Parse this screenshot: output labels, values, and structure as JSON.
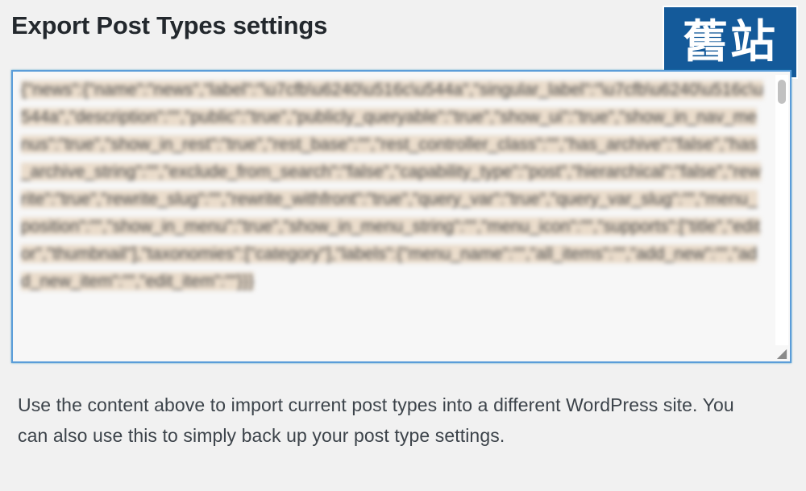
{
  "header": {
    "title": "Export Post Types settings"
  },
  "watermark": {
    "text": "舊站",
    "background_color": "#145a9a"
  },
  "export": {
    "content": "{\"news\":{\"name\":\"news\",\"label\":\"\\u7cfb\\u6240\\u516c\\u544a\",\"singular_label\":\"\\u7cfb\\u6240\\u516c\\u544a\",\"description\":\"\",\"public\":\"true\",\"publicly_queryable\":\"true\",\"show_ui\":\"true\",\"show_in_nav_menus\":\"true\",\"show_in_rest\":\"true\",\"rest_base\":\"\",\"rest_controller_class\":\"\",\"has_archive\":\"false\",\"has_archive_string\":\"\",\"exclude_from_search\":\"false\",\"capability_type\":\"post\",\"hierarchical\":\"false\",\"rewrite\":\"true\",\"rewrite_slug\":\"\",\"rewrite_withfront\":\"true\",\"query_var\":\"true\",\"query_var_slug\":\"\",\"menu_position\":\"\",\"show_in_menu\":\"true\",\"show_in_menu_string\":\"\",\"menu_icon\":\"\",\"supports\":[\"title\",\"editor\",\"thumbnail\"],\"taxonomies\":[\"category\"],\"labels\":{\"menu_name\":\"\",\"all_items\":\"\",\"add_new\":\"\",\"add_new_item\":\"\",\"edit_item\":\"\"}}}"
  },
  "help": {
    "text": "Use the content above to import current post types into a different WordPress site. You can also use this to simply back up your post type settings."
  }
}
